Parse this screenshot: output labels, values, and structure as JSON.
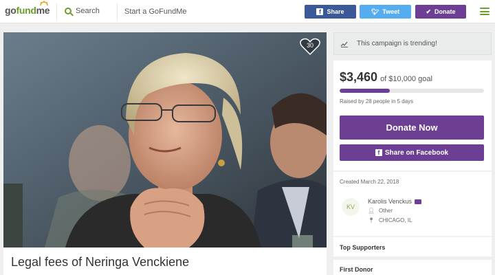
{
  "header": {
    "logo": {
      "go": "go",
      "fund": "fund",
      "me": "me"
    },
    "search_label": "Search",
    "start_label": "Start a GoFundMe",
    "share_label": "Share",
    "tweet_label": "Tweet",
    "donate_label": "Donate"
  },
  "campaign": {
    "title": "Legal fees of Neringa Venckiene",
    "hearts": "30",
    "trending": "This campaign is trending!",
    "raised_amount": "$3,460",
    "goal_text": "of $10,000 goal",
    "progress_fraction": 0.346,
    "raised_by": "Raised by 28 people in 5 days",
    "donate_now": "Donate Now",
    "share_facebook": "Share on Facebook",
    "created": "Created March 22, 2018"
  },
  "organizer": {
    "initials": "KV",
    "name": "Karolis Venckus",
    "relation": "Other",
    "location": "CHICAGO, IL"
  },
  "sections": {
    "top_supporters": "Top Supporters",
    "first_donor": "First Donor"
  },
  "colors": {
    "brand_green": "#6a9d2c",
    "donate_purple": "#6d3f94",
    "facebook_blue": "#3b5998",
    "twitter_blue": "#55acee"
  }
}
